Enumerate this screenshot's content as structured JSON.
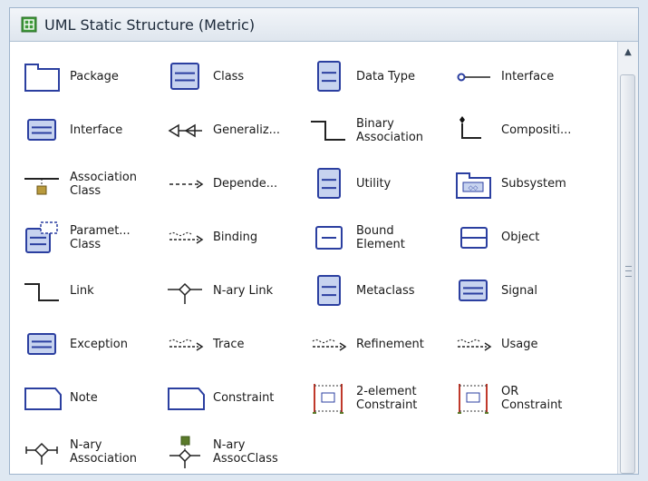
{
  "window": {
    "title": "UML Static Structure (Metric)",
    "icon": "stencil-icon"
  },
  "colors": {
    "shape_stroke": "#2b3fa0",
    "shape_fill": "#c7d3ef",
    "accent_red": "#c0392b",
    "accent_green": "#5a7a2a"
  },
  "shapes": [
    {
      "label": "Package",
      "icon": "package-icon"
    },
    {
      "label": "Class",
      "icon": "class-icon"
    },
    {
      "label": "Data Type",
      "icon": "data-type-icon"
    },
    {
      "label": "Interface",
      "icon": "interface-lollipop-icon"
    },
    {
      "label": "Interface",
      "icon": "interface-icon"
    },
    {
      "label": "Generaliz...",
      "icon": "generalization-arrow-icon"
    },
    {
      "label": "Binary\nAssociation",
      "icon": "binary-association-icon"
    },
    {
      "label": "Compositi...",
      "icon": "composition-icon"
    },
    {
      "label": "Association\nClass",
      "icon": "association-class-icon"
    },
    {
      "label": "Depende...",
      "icon": "dependency-arrow-icon"
    },
    {
      "label": "Utility",
      "icon": "utility-icon"
    },
    {
      "label": "Subsystem",
      "icon": "subsystem-icon"
    },
    {
      "label": "Paramet...\nClass",
      "icon": "parameterized-class-icon"
    },
    {
      "label": "Binding",
      "icon": "binding-arrow-icon"
    },
    {
      "label": "Bound\nElement",
      "icon": "bound-element-icon"
    },
    {
      "label": "Object",
      "icon": "object-icon"
    },
    {
      "label": "Link",
      "icon": "link-icon"
    },
    {
      "label": "N-ary Link",
      "icon": "nary-link-icon"
    },
    {
      "label": "Metaclass",
      "icon": "metaclass-icon"
    },
    {
      "label": "Signal",
      "icon": "signal-icon"
    },
    {
      "label": "Exception",
      "icon": "exception-icon"
    },
    {
      "label": "Trace",
      "icon": "trace-arrow-icon"
    },
    {
      "label": "Refinement",
      "icon": "refinement-arrow-icon"
    },
    {
      "label": "Usage",
      "icon": "usage-arrow-icon"
    },
    {
      "label": "Note",
      "icon": "note-icon"
    },
    {
      "label": "Constraint",
      "icon": "constraint-icon"
    },
    {
      "label": "2-element\nConstraint",
      "icon": "two-element-constraint-icon"
    },
    {
      "label": "OR\nConstraint",
      "icon": "or-constraint-icon"
    },
    {
      "label": "N-ary\nAssociation",
      "icon": "nary-association-icon"
    },
    {
      "label": "N-ary\nAssocClass",
      "icon": "nary-assocclass-icon"
    }
  ]
}
